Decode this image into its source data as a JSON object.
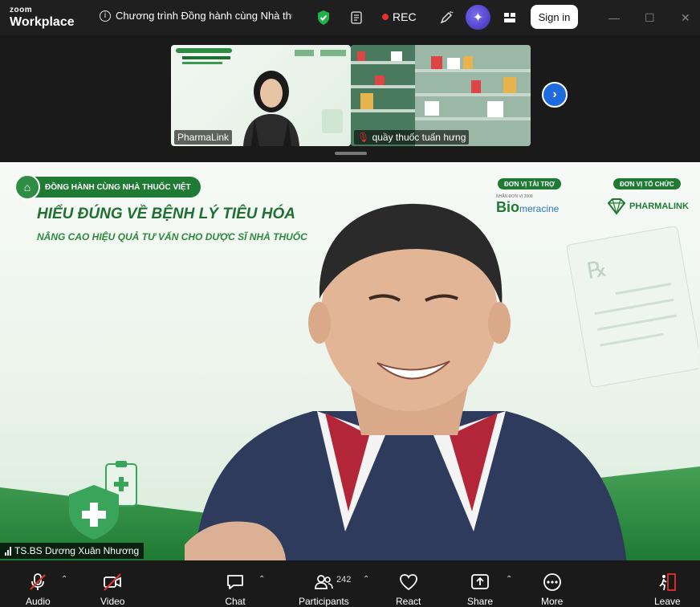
{
  "app": {
    "brand_small": "zoom",
    "brand_large": "Workplace"
  },
  "meeting": {
    "title": "Chương trình Đồng hành cùng Nhà thuố"
  },
  "header": {
    "rec_label": "REC",
    "signin_label": "Sign in"
  },
  "thumbnails": [
    {
      "name": "PharmaLink"
    },
    {
      "name": "quầy thuốc tuấn hưng"
    }
  ],
  "slide": {
    "banner": "ĐỒNG HÀNH CÙNG NHÀ THUỐC VIỆT",
    "headline": "HIỂU ĐÚNG VỀ BỆNH LÝ TIÊU HÓA",
    "subline": "NÂNG CAO HIỆU QUẢ TƯ VẤN CHO DƯỢC SĨ NHÀ THUỐC",
    "sponsor_tag": "ĐƠN VỊ TÀI TRỢ",
    "sponsor_small": "NHÃN ĐƠN VỊ 2008",
    "sponsor_logo_a": "Bio",
    "sponsor_logo_b": "meracine",
    "organizer_tag": "ĐƠN VỊ TỔ CHỨC",
    "organizer_logo": "PHARMALINK"
  },
  "speaker": {
    "name": "TS.BS Dương Xuân Nhương"
  },
  "toolbar": {
    "audio": "Audio",
    "video": "Video",
    "chat": "Chat",
    "participants": "Participants",
    "participants_count": "242",
    "react": "React",
    "share": "Share",
    "more": "More",
    "leave": "Leave"
  },
  "colors": {
    "accent_green": "#1f7a34",
    "rec_red": "#e5302e",
    "nav_blue": "#1d6bdc"
  }
}
